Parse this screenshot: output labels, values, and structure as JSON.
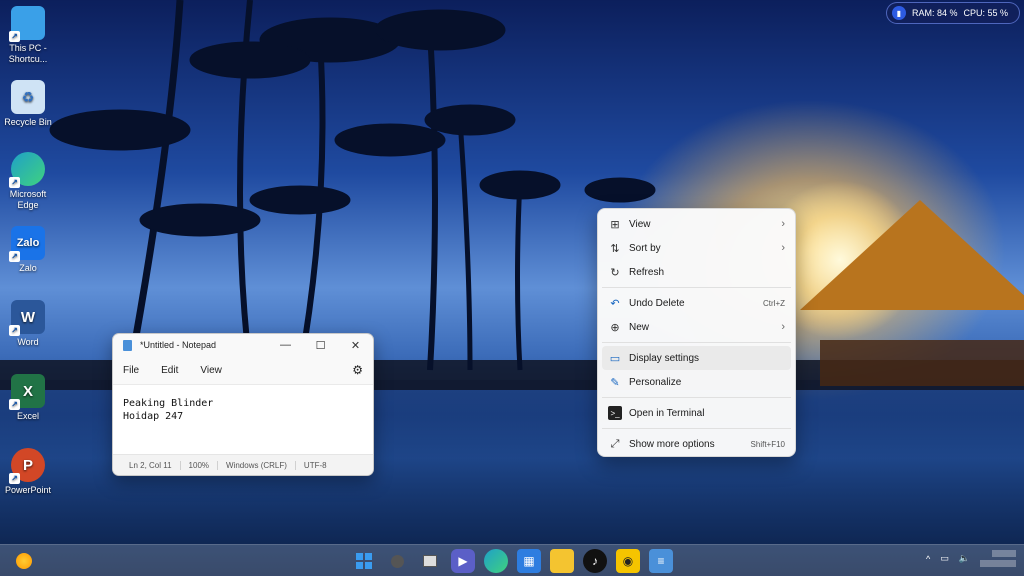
{
  "desktop": {
    "icons": [
      {
        "label": "This PC - Shortcu...",
        "glyph": "",
        "color": "#3aa0e8"
      },
      {
        "label": "Recycle Bin",
        "glyph": "",
        "color": "#cfe3f5"
      },
      {
        "label": "Microsoft Edge",
        "glyph": "",
        "color": "#1fa0c8"
      },
      {
        "label": "Zalo",
        "glyph": "Zalo",
        "color": "#1a73e8"
      },
      {
        "label": "Word",
        "glyph": "W",
        "color": "#2b579a"
      },
      {
        "label": "Excel",
        "glyph": "X",
        "color": "#217346"
      },
      {
        "label": "PowerPoint",
        "glyph": "P",
        "color": "#d24726"
      }
    ]
  },
  "widget": {
    "ram": "RAM: 84 %",
    "cpu": "CPU: 55 %"
  },
  "notepad": {
    "title": "*Untitled - Notepad",
    "menu": [
      "File",
      "Edit",
      "View"
    ],
    "content_lines": [
      "Peaking Blinder",
      "Hoidap 247"
    ],
    "status": {
      "position": "Ln 2, Col 11",
      "zoom": "100%",
      "line_ending": "Windows (CRLF)",
      "encoding": "UTF-8"
    }
  },
  "context_menu": {
    "items": [
      {
        "label": "View",
        "icon": "grid-icon",
        "shortcut": "",
        "submenu": true
      },
      {
        "label": "Sort by",
        "icon": "sort-icon",
        "shortcut": "",
        "submenu": true
      },
      {
        "label": "Refresh",
        "icon": "refresh-icon",
        "shortcut": "",
        "submenu": false
      },
      {
        "label": "Undo Delete",
        "icon": "undo-icon",
        "shortcut": "Ctrl+Z",
        "submenu": false
      },
      {
        "label": "New",
        "icon": "plus-circle-icon",
        "shortcut": "",
        "submenu": true
      },
      {
        "label": "Display settings",
        "icon": "display-icon",
        "shortcut": "",
        "submenu": false
      },
      {
        "label": "Personalize",
        "icon": "pen-icon",
        "shortcut": "",
        "submenu": false
      },
      {
        "label": "Open in Terminal",
        "icon": "terminal-icon",
        "shortcut": "",
        "submenu": false
      },
      {
        "label": "Show more options",
        "icon": "more-options-icon",
        "shortcut": "Shift+F10",
        "submenu": false
      }
    ],
    "highlighted": "Display settings"
  },
  "taskbar": {
    "apps": [
      "start-icon",
      "search-icon",
      "task-view-icon",
      "meet-icon",
      "edge-icon",
      "store-icon",
      "file-explorer-icon",
      "tiktok-icon",
      "app-icon",
      "notepad-icon"
    ]
  },
  "colors": {
    "accent": "#1565c0",
    "menu_bg": "#fafafa",
    "highlight": "#eaeaea"
  }
}
